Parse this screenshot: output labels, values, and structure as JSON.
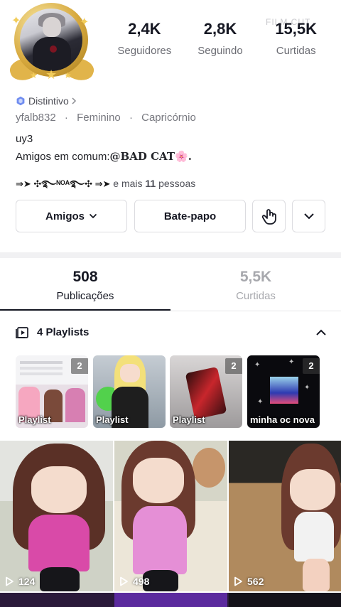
{
  "profile": {
    "stats": [
      {
        "value": "2,4K",
        "label": "Seguidores"
      },
      {
        "value": "2,8K",
        "label": "Seguindo"
      },
      {
        "value": "15,5K",
        "label": "Curtidas"
      }
    ],
    "watermark": "FILM CUT",
    "badge_label": "Distintivo",
    "username": "yfalb832",
    "gender": "Feminino",
    "sign": "Capricórnio",
    "bio": "uy3",
    "mutual_prefix": "Amigos em comum:",
    "mutual_name": "@BAD CAT🌸.",
    "friends_names": "⇒➤ ✣࿐ᴺᴼᴬ࿐✣ ⇒➤",
    "friends_suffix_pre": "e mais",
    "friends_count": "11",
    "friends_suffix_post": "pessoas"
  },
  "actions": {
    "friends_label": "Amigos",
    "chat_label": "Bate-papo"
  },
  "tabs": [
    {
      "count": "508",
      "label": "Publicações",
      "active": true
    },
    {
      "count": "5,5K",
      "label": "Curtidas",
      "active": false
    }
  ],
  "playlists": {
    "title": "4 Playlists",
    "items": [
      {
        "name": "Playlist",
        "count": "2"
      },
      {
        "name": "Playlist",
        "count": ""
      },
      {
        "name": "Playlist",
        "count": "2"
      },
      {
        "name": "minha oc nova",
        "count": "2"
      }
    ]
  },
  "videos": [
    {
      "views": "124"
    },
    {
      "views": "498"
    },
    {
      "views": "562"
    }
  ],
  "colors": {
    "text_primary": "#161823",
    "text_secondary": "#77787f",
    "badge_blue": "#6f8cf0",
    "gold": "#d6a83d"
  }
}
